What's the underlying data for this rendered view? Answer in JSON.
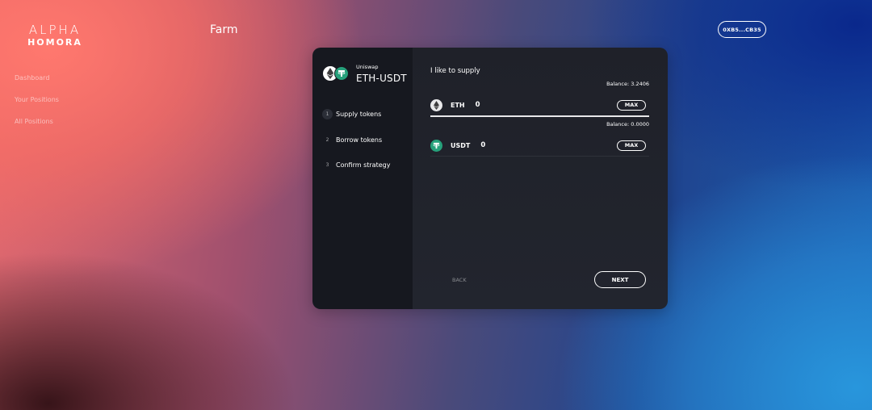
{
  "brand": {
    "line1": "ALPHA",
    "line2": "HOMORA"
  },
  "nav": {
    "items": [
      {
        "label": "Dashboard"
      },
      {
        "label": "Your Positions"
      },
      {
        "label": "All Positions"
      }
    ]
  },
  "page": {
    "title": "Farm"
  },
  "wallet": {
    "address": "0XB5...CB35"
  },
  "farm": {
    "protocol": "Uniswap",
    "pair": "ETH-USDT",
    "steps": [
      {
        "num": "1",
        "label": "Supply tokens",
        "active": true
      },
      {
        "num": "2",
        "label": "Borrow tokens",
        "active": false
      },
      {
        "num": "3",
        "label": "Confirm strategy",
        "active": false
      }
    ],
    "supply": {
      "title": "I like to supply",
      "tokens": [
        {
          "symbol": "ETH",
          "amount": "0",
          "balance": "Balance: 3.2406",
          "max_label": "MAX",
          "icon": "eth-icon"
        },
        {
          "symbol": "USDT",
          "amount": "0",
          "balance": "Balance: 0.0000",
          "max_label": "MAX",
          "icon": "usdt-icon"
        }
      ]
    },
    "buttons": {
      "back": "BACK",
      "next": "NEXT"
    }
  },
  "colors": {
    "usdt": "#26a17b",
    "card_left": "#16181f",
    "card_right": "#20232b"
  }
}
